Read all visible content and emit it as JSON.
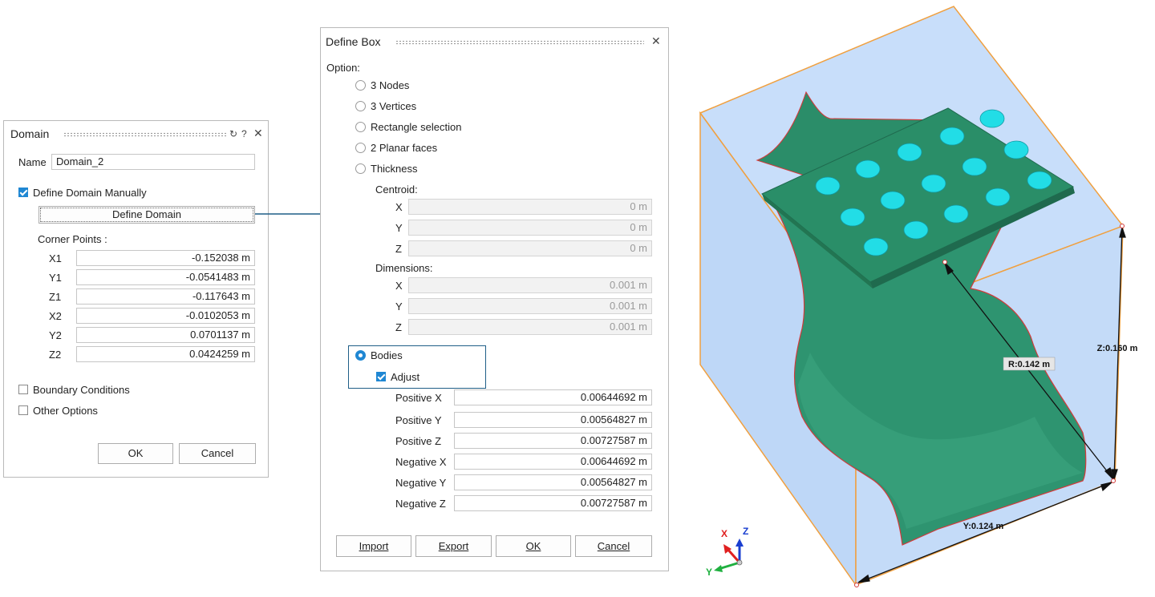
{
  "domain_dialog": {
    "title": "Domain",
    "name_label": "Name",
    "name_value": "Domain_2",
    "define_manually_label": "Define Domain Manually",
    "define_manually_checked": true,
    "define_domain_button": "Define Domain",
    "corner_points_label": "Corner Points :",
    "corner_points": [
      {
        "label": "X1",
        "value": "-0.152038 m"
      },
      {
        "label": "Y1",
        "value": "-0.0541483 m"
      },
      {
        "label": "Z1",
        "value": "-0.117643 m"
      },
      {
        "label": "X2",
        "value": "-0.0102053 m"
      },
      {
        "label": "Y2",
        "value": "0.0701137 m"
      },
      {
        "label": "Z2",
        "value": "0.0424259 m"
      }
    ],
    "boundary_conditions_label": "Boundary Conditions",
    "other_options_label": "Other Options",
    "ok_label": "OK",
    "cancel_label": "Cancel"
  },
  "box_dialog": {
    "title": "Define Box",
    "option_label": "Option:",
    "options": [
      "3 Nodes",
      "3 Vertices",
      "Rectangle selection",
      "2 Planar faces",
      "Thickness"
    ],
    "centroid_label": "Centroid:",
    "centroid": [
      {
        "label": "X",
        "value": "0 m"
      },
      {
        "label": "Y",
        "value": "0 m"
      },
      {
        "label": "Z",
        "value": "0 m"
      }
    ],
    "dimensions_label": "Dimensions:",
    "dimensions": [
      {
        "label": "X",
        "value": "0.001 m"
      },
      {
        "label": "Y",
        "value": "0.001 m"
      },
      {
        "label": "Z",
        "value": "0.001 m"
      }
    ],
    "bodies_label": "Bodies",
    "adjust_label": "Adjust",
    "adjust_checked": true,
    "offsets": [
      {
        "label": "Positive X",
        "value": "0.00644692 m"
      },
      {
        "label": "Positive Y",
        "value": "0.00564827 m"
      },
      {
        "label": "Positive Z",
        "value": "0.00727587 m"
      },
      {
        "label": "Negative X",
        "value": "0.00644692 m"
      },
      {
        "label": "Negative Y",
        "value": "0.00564827 m"
      },
      {
        "label": "Negative Z",
        "value": "0.00727587 m"
      }
    ],
    "import_label": "Import",
    "export_label": "Export",
    "ok_label": "OK",
    "cancel_label": "Cancel"
  },
  "viewport": {
    "dim_r": "R:0.142 m",
    "dim_z": "Z:0.160 m",
    "dim_y": "Y:0.124 m",
    "triad_x": "X",
    "triad_y": "Y",
    "triad_z": "Z"
  },
  "colors": {
    "accent": "#1f87d3",
    "box_face": "#c8defa",
    "box_edge": "#f0a040",
    "part_green": "#2e9470",
    "pad_cyan": "#22dde6",
    "edge_red": "#d23a3a",
    "link_arrow": "#1f5e87"
  }
}
